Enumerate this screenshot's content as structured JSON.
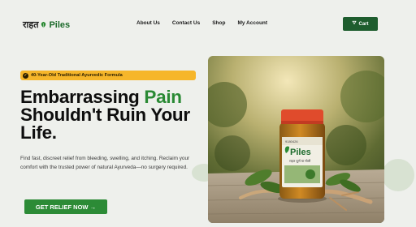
{
  "brand": {
    "name_a": "राहत",
    "name_b": "Piles",
    "accent": "#2a8a34",
    "dark_green": "#1e5d2e"
  },
  "nav": {
    "items": [
      "About Us",
      "Contact Us",
      "Shop",
      "My Account"
    ]
  },
  "cart": {
    "label": "Cart",
    "icon": "cart-icon"
  },
  "hero": {
    "badge_text": "40-Year-Old Traditional Ayurvedic Formula",
    "badge_icon": "shield-icon",
    "badge_color": "#f6b62a",
    "headline_1": "Embarrassing ",
    "headline_highlight": "Pain",
    "headline_2": "Shouldn't Ruin Your Life.",
    "description": "Find fast, discreet relief from bleeding, swelling, and itching. Reclaim your comfort with the trusted power of natural Ayurveda—no surgery required.",
    "cta_label": "GET RELIEF NOW →"
  },
  "product_image": {
    "jar_label_top": "राहत",
    "jar_label_main": "Piles",
    "jar_small_text": "राहत चूर्ण या गोली",
    "jar_number": "9180426"
  }
}
